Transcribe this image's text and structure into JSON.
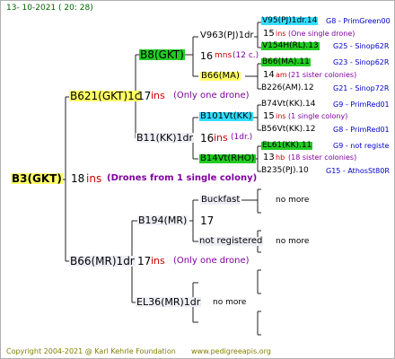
{
  "header": {
    "date": "13- 10-2021 ( 20: 28)"
  },
  "root": {
    "name": "B3(GKT)",
    "count": "18",
    "ins": "ins",
    "note": "(Drones from 1 single colony)"
  },
  "gen1": {
    "top": {
      "name": "B621(GKT)1c",
      "count": "17",
      "ins": "ins",
      "note": "(Only one drone)"
    },
    "bottom": {
      "name": "B66(MR)1dr",
      "count": "17",
      "ins": "ins",
      "note": "(Only one drone)"
    }
  },
  "gen2": {
    "a": {
      "name": "B8(GKT)"
    },
    "b": {
      "name": "B11(KK)1dr",
      "count": "16",
      "ins": "ins",
      "note": "(1dr.)"
    },
    "c": {
      "name": "B194(MR)",
      "count": "17"
    },
    "d": {
      "name": "EL36(MR)1dr",
      "more": "no more"
    }
  },
  "gen3": {
    "a": {
      "name": "V963(PJ)1dr",
      "count": "16",
      "ins": "mns",
      "note": "(12 c.)"
    },
    "b": {
      "name": "B66(MA)"
    },
    "c": {
      "name": "B101Vt(KK)",
      "count": "15",
      "ins": "ins",
      "note": "(1 single colony)"
    },
    "d": {
      "name": "B14Vt(RHO)",
      "count": "13",
      "ins": "hb",
      "note": "(18 sister colonies)"
    },
    "e": {
      "name": "Buckfast",
      "more": "no more"
    },
    "f": {
      "name": "not registered",
      "more": "no more"
    }
  },
  "gen4": {
    "r1": {
      "name": "V95(PJ)1dr.14",
      "code": "G8 - PrimGreen00"
    },
    "r2": {
      "count": "15",
      "ins": "ins",
      "note": "(One single drone)"
    },
    "r3": {
      "name": "V154H(RL).13",
      "code": "G25 - Sinop62R"
    },
    "r4": {
      "name": "B66(MA).11",
      "code": "G23 - Sinop62R"
    },
    "r5": {
      "count": "14",
      "ins": "am",
      "note": "(21 sister colonies)"
    },
    "r6": {
      "name": "B226(AM).12",
      "code": "G21 - Sinop72R"
    },
    "r7": {
      "name": "B74Vt(KK).14",
      "code": "G9 - PrimRed01"
    },
    "r8": {
      "count": "15",
      "ins": "ins",
      "note": "(1 single colony)"
    },
    "r9": {
      "name": "B56Vt(KK).12",
      "code": "G8 - PrimRed01"
    },
    "r10": {
      "name": "EL61(KK).11",
      "code": "G9 - not registe"
    },
    "r11": {
      "count": "13",
      "ins": "hb",
      "note": "(18 sister colonies)"
    },
    "r12": {
      "name": "B235(PJ).10",
      "code": "G15 - AthosSt80R"
    }
  },
  "footer": {
    "copyright": "Copyright 2004-2021 @ Karl Kehrle Foundation",
    "url": "www.pedigreeapis.org"
  },
  "colors": {
    "yellow": "#ffff66",
    "green": "#22cc22",
    "cyan": "#33ddff",
    "red": "#cc0000",
    "blue": "#0000cc",
    "purple": "#8000a0"
  }
}
